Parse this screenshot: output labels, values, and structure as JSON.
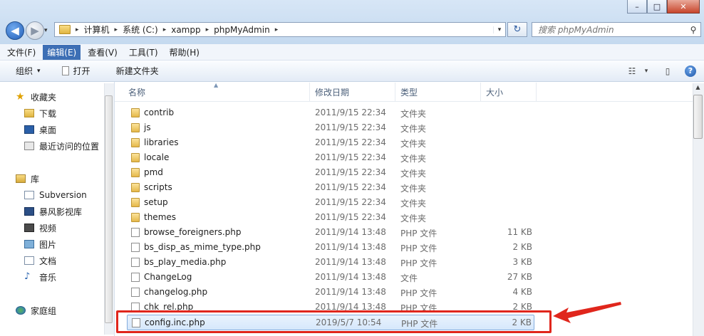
{
  "window": {
    "controls": [
      "–",
      "□",
      "✕"
    ]
  },
  "nav": {
    "back_glyph": "◀",
    "forward_glyph": "▶",
    "recent_glyph": "▾"
  },
  "address": {
    "crumbs": [
      "计算机",
      "系统 (C:)",
      "xampp",
      "phpMyAdmin"
    ],
    "separator": "▸",
    "dropdown_glyph": "▾",
    "refresh_glyph": "↻"
  },
  "search": {
    "placeholder": "搜索 phpMyAdmin",
    "icon": "search-icon"
  },
  "menu": [
    "文件(F)",
    "编辑(E)",
    "查看(V)",
    "工具(T)",
    "帮助(H)"
  ],
  "toolbar": {
    "organize_label": "组织",
    "organize_arrow": "▾",
    "open_label": "打开",
    "new_folder_label": "新建文件夹",
    "view_glyph": "☷",
    "view_arrow": "▾",
    "preview_glyph": "▯",
    "help_glyph": "?"
  },
  "nav_pane": {
    "favorites_header": "收藏夹",
    "favorites": [
      "下载",
      "桌面",
      "最近访问的位置"
    ],
    "libraries_header": "库",
    "libraries": [
      "Subversion",
      "暴风影视库",
      "视频",
      "图片",
      "文档",
      "音乐"
    ],
    "homegroup": "家庭组"
  },
  "columns": {
    "name": "名称",
    "date": "修改日期",
    "type": "类型",
    "size": "大小"
  },
  "files": [
    {
      "name": "contrib",
      "date": "2011/9/15 22:34",
      "type": "文件夹",
      "size": "",
      "kind": "folder"
    },
    {
      "name": "js",
      "date": "2011/9/15 22:34",
      "type": "文件夹",
      "size": "",
      "kind": "folder"
    },
    {
      "name": "libraries",
      "date": "2011/9/15 22:34",
      "type": "文件夹",
      "size": "",
      "kind": "folder"
    },
    {
      "name": "locale",
      "date": "2011/9/15 22:34",
      "type": "文件夹",
      "size": "",
      "kind": "folder"
    },
    {
      "name": "pmd",
      "date": "2011/9/15 22:34",
      "type": "文件夹",
      "size": "",
      "kind": "folder"
    },
    {
      "name": "scripts",
      "date": "2011/9/15 22:34",
      "type": "文件夹",
      "size": "",
      "kind": "folder"
    },
    {
      "name": "setup",
      "date": "2011/9/15 22:34",
      "type": "文件夹",
      "size": "",
      "kind": "folder"
    },
    {
      "name": "themes",
      "date": "2011/9/15 22:34",
      "type": "文件夹",
      "size": "",
      "kind": "folder"
    },
    {
      "name": "browse_foreigners.php",
      "date": "2011/9/14 13:48",
      "type": "PHP 文件",
      "size": "11 KB",
      "kind": "file"
    },
    {
      "name": "bs_disp_as_mime_type.php",
      "date": "2011/9/14 13:48",
      "type": "PHP 文件",
      "size": "2 KB",
      "kind": "file"
    },
    {
      "name": "bs_play_media.php",
      "date": "2011/9/14 13:48",
      "type": "PHP 文件",
      "size": "3 KB",
      "kind": "file"
    },
    {
      "name": "ChangeLog",
      "date": "2011/9/14 13:48",
      "type": "文件",
      "size": "27 KB",
      "kind": "file"
    },
    {
      "name": "changelog.php",
      "date": "2011/9/14 13:48",
      "type": "PHP 文件",
      "size": "4 KB",
      "kind": "file"
    },
    {
      "name": "chk_rel.php",
      "date": "2011/9/14 13:48",
      "type": "PHP 文件",
      "size": "2 KB",
      "kind": "file"
    },
    {
      "name": "config.inc.php",
      "date": "2019/5/7 10:54",
      "type": "PHP 文件",
      "size": "2 KB",
      "kind": "file",
      "selected": true
    }
  ],
  "colors": {
    "annotation": "#e0261c",
    "selection_border": "#84acdd",
    "menu_active": "#3d6fb5"
  }
}
